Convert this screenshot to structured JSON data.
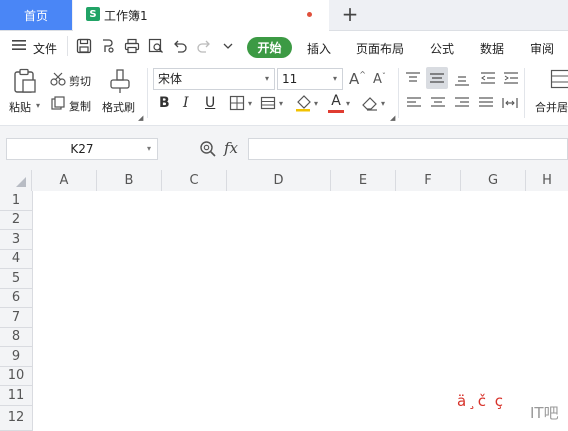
{
  "tabs": {
    "home": "首页",
    "document": "工作簿1",
    "doc_icon": "S",
    "new_tab": "+"
  },
  "menu": {
    "file": "文件",
    "start": "开始",
    "items": [
      "插入",
      "页面布局",
      "公式",
      "数据",
      "审阅"
    ]
  },
  "ribbon": {
    "paste": "粘贴",
    "cut": "剪切",
    "copy": "复制",
    "format_painter": "格式刷",
    "font_name": "宋体",
    "font_size": "11",
    "merge_center": "合并居"
  },
  "formula_bar": {
    "name_box": "K27",
    "fx": "fx",
    "formula": ""
  },
  "grid": {
    "columns": [
      "A",
      "B",
      "C",
      "D",
      "E",
      "F",
      "G",
      "H"
    ],
    "rows": [
      "1",
      "2",
      "3",
      "4",
      "5",
      "6",
      "7",
      "8",
      "9",
      "10",
      "11",
      "12"
    ]
  },
  "watermark": {
    "text": "ä¸č ç",
    "suffix": "IT吧"
  },
  "colors": {
    "home_tab": "#4a86f6",
    "start_button": "#3c9a44",
    "doc_icon": "#21a366"
  }
}
